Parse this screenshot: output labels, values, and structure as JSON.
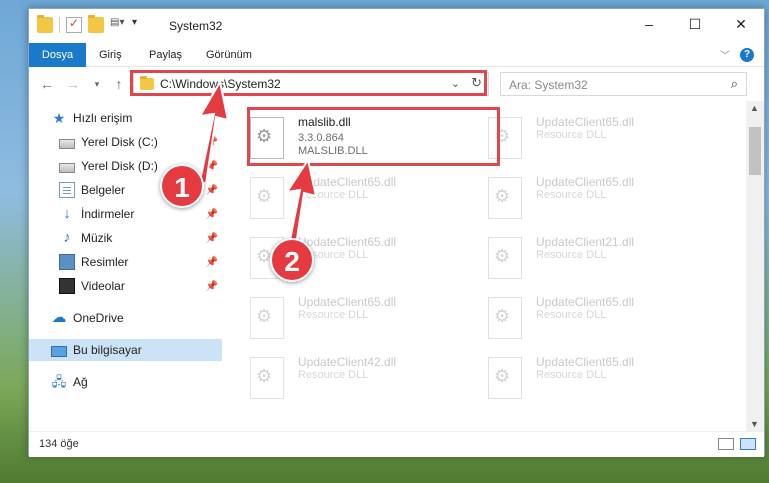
{
  "window": {
    "title": "System32",
    "controls": {
      "minimize": "–",
      "maximize": "☐",
      "close": "✕"
    }
  },
  "ribbon": {
    "tabs": [
      "Dosya",
      "Giriş",
      "Paylaş",
      "Görünüm"
    ],
    "help": "?"
  },
  "nav": {
    "address_path": "C:\\Windows\\System32",
    "search_placeholder": "Ara: System32"
  },
  "sidebar": {
    "items": [
      {
        "label": "Hızlı erişim",
        "icon": "star-icon"
      },
      {
        "label": "Yerel Disk (C:)",
        "icon": "disk-icon",
        "pinned": true
      },
      {
        "label": "Yerel Disk (D:)",
        "icon": "disk-icon",
        "pinned": true
      },
      {
        "label": "Belgeler",
        "icon": "documents-icon",
        "pinned": true
      },
      {
        "label": "İndirmeler",
        "icon": "download-icon",
        "pinned": true
      },
      {
        "label": "Müzik",
        "icon": "music-icon",
        "pinned": true
      },
      {
        "label": "Resimler",
        "icon": "pictures-icon",
        "pinned": true
      },
      {
        "label": "Videolar",
        "icon": "videos-icon",
        "pinned": true
      },
      {
        "label": "OneDrive",
        "icon": "cloud-icon"
      },
      {
        "label": "Bu bilgisayar",
        "icon": "computer-icon",
        "selected": true
      },
      {
        "label": "Ağ",
        "icon": "network-icon"
      }
    ]
  },
  "files": {
    "main": {
      "name": "malslib.dll",
      "version": "3.3.0.864",
      "desc": "MALSLIB.DLL"
    },
    "faded": [
      {
        "name": "UpdateClient65.dll",
        "desc": "Resource DLL"
      },
      {
        "name": "UpdateClient65.dll",
        "desc": "Resource DLL"
      },
      {
        "name": "UpdateClient65.dll",
        "desc": "Resource DLL"
      },
      {
        "name": "UpdateClient65.dll",
        "desc": "Resource DLL"
      },
      {
        "name": "UpdateClient21.dll",
        "desc": "Resource DLL"
      },
      {
        "name": "UpdateClient65.dll",
        "desc": "Resource DLL"
      },
      {
        "name": "UpdateClient65.dll",
        "desc": "Resource DLL"
      },
      {
        "name": "UpdateClient42.dll",
        "desc": "Resource DLL"
      },
      {
        "name": "UpdateClient65.dll",
        "desc": "Resource DLL"
      }
    ]
  },
  "status": {
    "count": "134 öğe"
  },
  "annotations": {
    "step1": "1",
    "step2": "2"
  },
  "colors": {
    "accent": "#1979ca",
    "highlight": "#e0474c",
    "badge": "#e53a40",
    "selected": "#cce3f7"
  }
}
